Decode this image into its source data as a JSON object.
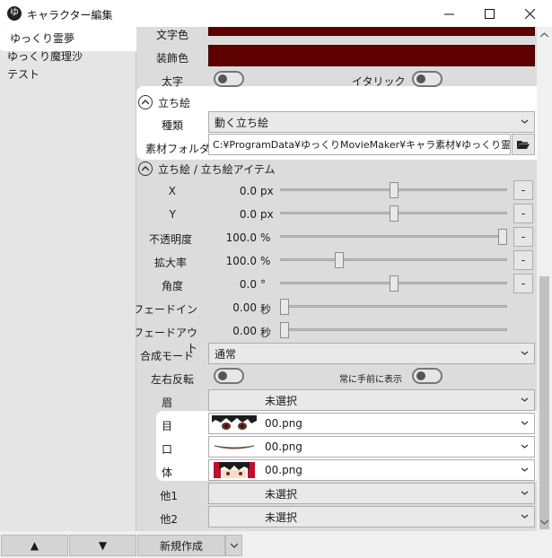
{
  "window": {
    "title": "キャラクター編集",
    "app_icon": "ゆ"
  },
  "characters": [
    {
      "name": "ゆっくり霊夢",
      "selected": true
    },
    {
      "name": "ゆっくり魔理沙",
      "selected": false
    },
    {
      "name": "テスト",
      "selected": false
    }
  ],
  "bottom": {
    "up": "▲",
    "down": "▼",
    "new": "新規作成"
  },
  "text": {
    "font_color_label": "文字色",
    "deco_color_label": "装飾色",
    "deco_color": "#5e0000",
    "bold_label": "太字",
    "italic_label": "イタリック"
  },
  "tachie": {
    "section": "立ち絵",
    "type_label": "種類",
    "type_value": "動く立ち絵",
    "folder_label": "素材フォルダ",
    "folder_value": "C:¥ProgramData¥ゆっくりMovieMaker¥キャラ素材¥ゆっくり霊夢"
  },
  "items": {
    "section": "立ち絵 / 立ち絵アイテム",
    "params": [
      {
        "label": "X",
        "value": "0.0",
        "unit": "px",
        "level": 0.5,
        "minus": "-"
      },
      {
        "label": "Y",
        "value": "0.0",
        "unit": "px",
        "level": 0.5,
        "minus": "-"
      },
      {
        "label": "不透明度",
        "value": "100.0",
        "unit": "%",
        "level": 1.0,
        "minus": "-"
      },
      {
        "label": "拡大率",
        "value": "100.0",
        "unit": "%",
        "level": 0.25,
        "minus": "-"
      },
      {
        "label": "角度",
        "value": "0.0",
        "unit": "°",
        "level": 0.5,
        "minus": "-"
      },
      {
        "label": "フェードイン",
        "value": "0.00",
        "unit": "秒",
        "level": 0.0
      },
      {
        "label": "フェードアウト",
        "value": "0.00",
        "unit": "秒",
        "level": 0.0
      }
    ],
    "blend_label": "合成モード",
    "blend_value": "通常",
    "flip_label": "左右反転",
    "front_label": "常に手前に表示",
    "parts": [
      {
        "label": "眉",
        "value": "未選択"
      },
      {
        "label": "目",
        "value": "00.png"
      },
      {
        "label": "口",
        "value": "00.png"
      },
      {
        "label": "体",
        "value": "00.png"
      },
      {
        "label": "他1",
        "value": "未選択"
      },
      {
        "label": "他2",
        "value": "未選択"
      }
    ]
  }
}
